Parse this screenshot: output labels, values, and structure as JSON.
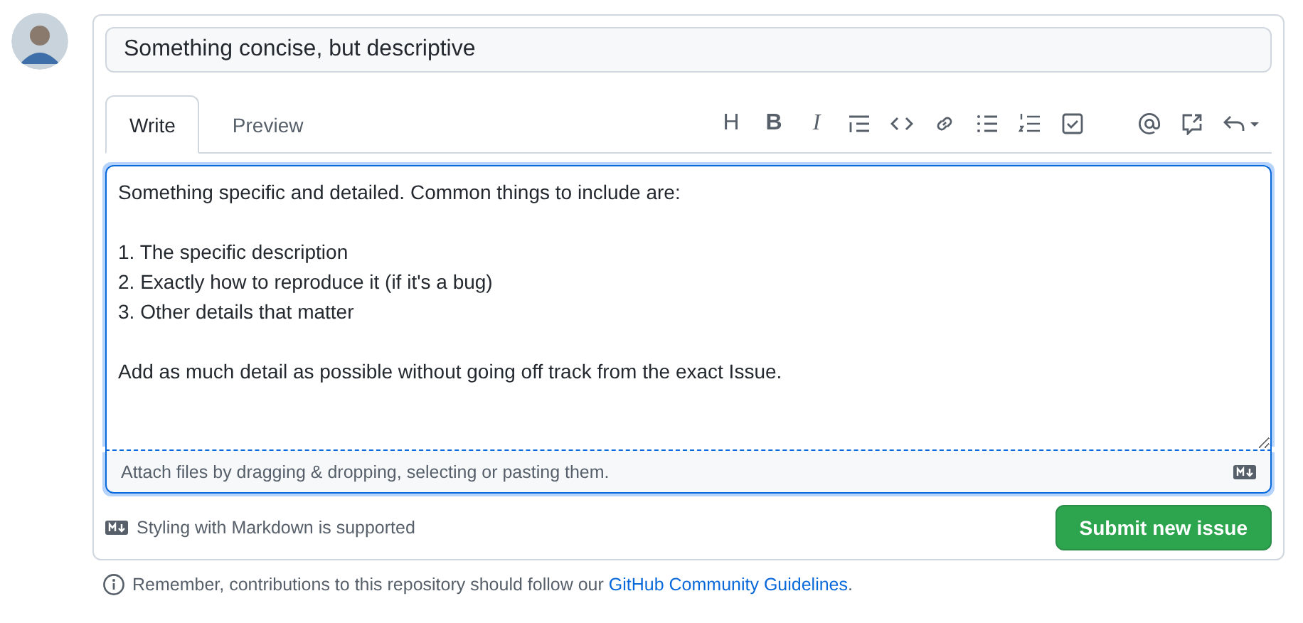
{
  "title_field": {
    "value": "Something concise, but descriptive"
  },
  "tabs": [
    {
      "label": "Write",
      "selected": true
    },
    {
      "label": "Preview",
      "selected": false
    }
  ],
  "toolbar": [
    {
      "kind": "heading",
      "label": "H"
    },
    {
      "kind": "bold",
      "label": "B"
    },
    {
      "kind": "italic",
      "label": "I"
    },
    {
      "kind": "quote"
    },
    {
      "kind": "code"
    },
    {
      "kind": "link"
    },
    {
      "kind": "bullets"
    },
    {
      "kind": "numbers"
    },
    {
      "kind": "task"
    },
    {
      "kind": "gap"
    },
    {
      "kind": "mention"
    },
    {
      "kind": "reference"
    },
    {
      "kind": "reply"
    }
  ],
  "body": {
    "paragraphs": [
      "Something specific and detailed. Common things to include are:",
      "1. The specific description\n2. Exactly how to reproduce it (if it's a bug)\n3. Other details that matter",
      "Add as much detail as possible without going off track from the exact Issue."
    ]
  },
  "attach_hint": "Attach files by dragging & dropping, selecting or pasting them.",
  "markdown_note": "Styling with Markdown is supported",
  "submit_button": "Submit new issue",
  "guidelines": {
    "text": "Remember, contributions to this repository should follow our ",
    "link": "GitHub Community Guidelines",
    "end": "."
  }
}
